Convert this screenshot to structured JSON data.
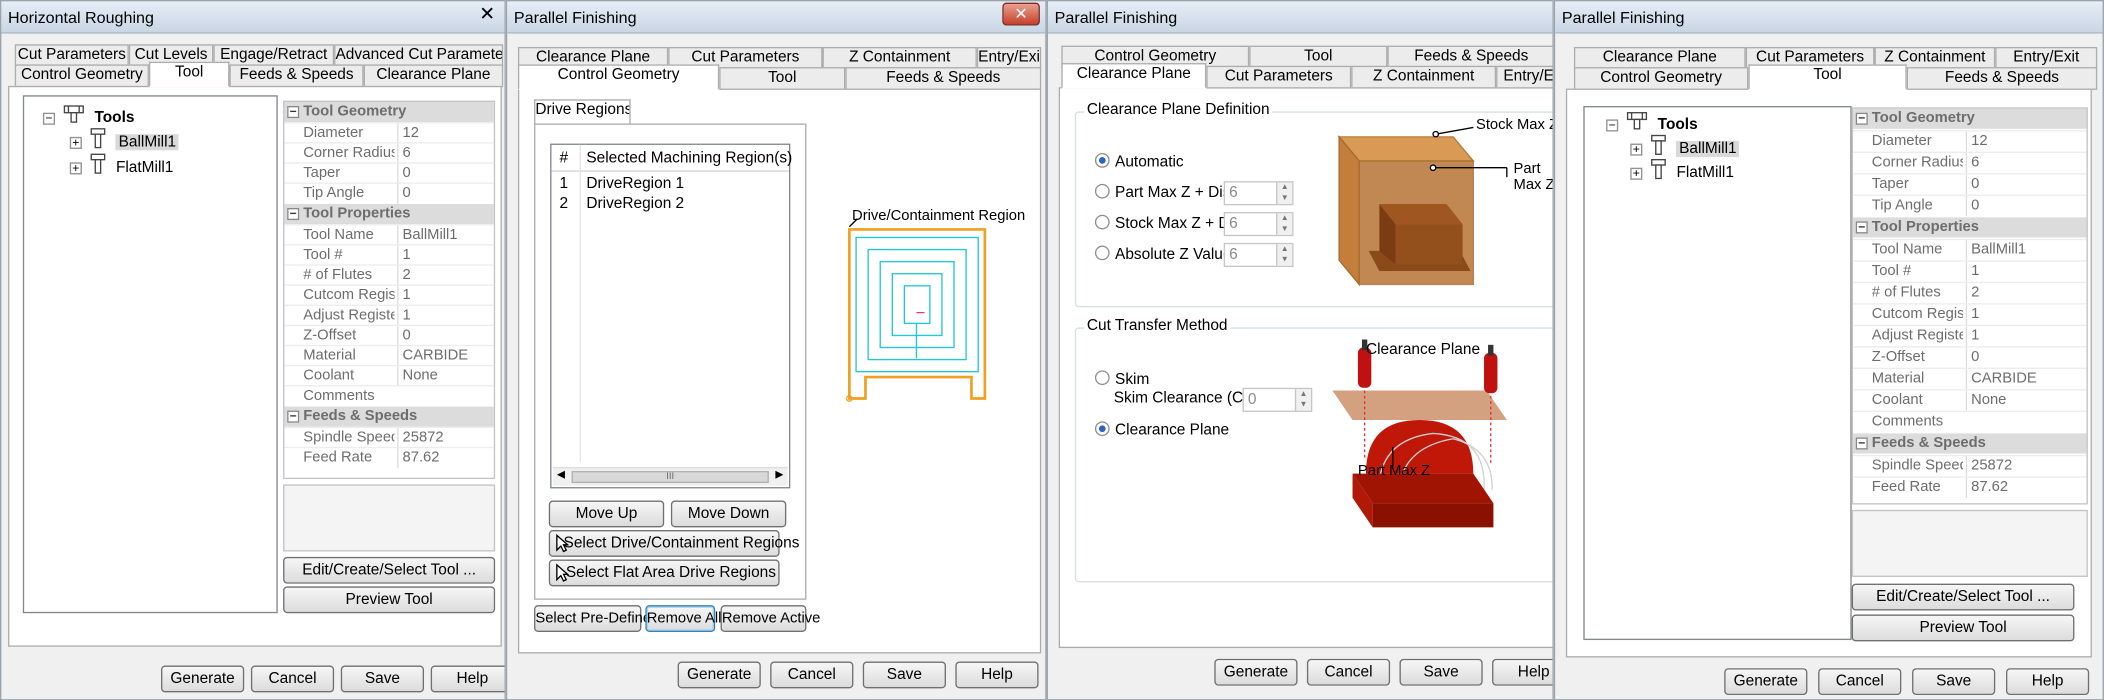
{
  "colors": {
    "title_bar": "#c9d6e4",
    "close": "#c7402c",
    "selection": "#d9d9d9",
    "drive_outline": "#f0a020",
    "toolpath": "#20c8d8",
    "model_orange": "#c46416",
    "model_red": "#c01808"
  },
  "common": {
    "generate": "Generate",
    "cancel": "Cancel",
    "save": "Save",
    "help": "Help"
  },
  "tool_tree": {
    "root": "Tools",
    "tools": [
      "BallMill1",
      "FlatMill1"
    ],
    "icon": "tool-holder-icon",
    "expander": "+"
  },
  "tool_props": {
    "geometry": {
      "title": "Tool Geometry",
      "rows": [
        {
          "k": "Diameter",
          "v": "12"
        },
        {
          "k": "Corner Radius",
          "v": "6"
        },
        {
          "k": "Taper",
          "v": "0"
        },
        {
          "k": "Tip Angle",
          "v": "0"
        }
      ]
    },
    "properties": {
      "title": "Tool Properties",
      "rows": [
        {
          "k": "Tool Name",
          "v": "BallMill1"
        },
        {
          "k": "Tool #",
          "v": "1"
        },
        {
          "k": "# of Flutes",
          "v": "2"
        },
        {
          "k": "Cutcom Register",
          "v": "1"
        },
        {
          "k": "Adjust Register",
          "v": "1"
        },
        {
          "k": "Z-Offset",
          "v": "0"
        },
        {
          "k": "Material",
          "v": "CARBIDE"
        },
        {
          "k": "Coolant",
          "v": "None"
        },
        {
          "k": "Comments",
          "v": ""
        }
      ]
    },
    "feeds": {
      "title": "Feeds & Speeds",
      "rows": [
        {
          "k": "Spindle Speed",
          "v": "25872"
        },
        {
          "k": "Feed Rate",
          "v": "87.62"
        }
      ]
    },
    "collapse": "−",
    "edit_button": "Edit/Create/Select Tool ...",
    "preview_button": "Preview Tool"
  },
  "w1": {
    "title": "Horizontal Roughing",
    "close": "✕",
    "tabs_top": [
      "Cut Parameters",
      "Cut Levels",
      "Engage/Retract",
      "Advanced Cut Parameters"
    ],
    "tabs_bottom": [
      "Control Geometry",
      "Tool",
      "Feeds & Speeds",
      "Clearance Plane"
    ]
  },
  "w2": {
    "title": "Parallel Finishing",
    "close": "✕",
    "tabs_top": [
      "Clearance Plane",
      "Cut Parameters",
      "Z Containment",
      "Entry/Exit"
    ],
    "tabs_bottom": [
      "Control Geometry",
      "Tool",
      "Feeds & Speeds"
    ],
    "inner_tab": "Drive Regions",
    "grid": {
      "headers": [
        "#",
        "Selected Machining Region(s)"
      ],
      "rows": [
        {
          "n": "1",
          "name": "DriveRegion 1"
        },
        {
          "n": "2",
          "name": "DriveRegion 2"
        }
      ],
      "scroll_glyph": "III"
    },
    "move_up": "Move Up",
    "move_down": "Move Down",
    "select_drive": "Select Drive/Containment Regions",
    "select_flat": "Select Flat Area Drive Regions",
    "select_predefined": "Select Pre-Defined",
    "remove_all": "Remove All",
    "remove_active": "Remove Active",
    "diagram_label": "Drive/Containment Region"
  },
  "w3": {
    "title": "Parallel Finishing",
    "tabs_top": [
      "Control Geometry",
      "Tool",
      "Feeds & Speeds"
    ],
    "tabs_bottom": [
      "Clearance Plane",
      "Cut Parameters",
      "Z Containment",
      "Entry/Exit"
    ],
    "clearance_group": "Clearance Plane Definition",
    "options": [
      {
        "label": "Automatic",
        "on": true,
        "value": ""
      },
      {
        "label": "Part Max Z + Dist",
        "on": false,
        "value": "6"
      },
      {
        "label": "Stock Max Z + Dist",
        "on": false,
        "value": "6"
      },
      {
        "label": "Absolute Z Value",
        "on": false,
        "value": "6"
      }
    ],
    "stock_label": "Stock Max Z",
    "part_label_1": "Part",
    "part_label_2": "Max Z",
    "transfer_group": "Cut Transfer Method",
    "skim": "Skim",
    "skim_clearance": "Skim Clearance (C)",
    "skim_value": "0",
    "clearance_plane": "Clearance Plane",
    "img_clearance_label": "Clearance Plane",
    "img_part_label": "Part Max Z"
  },
  "w4": {
    "title": "Parallel Finishing",
    "tabs_top": [
      "Clearance Plane",
      "Cut Parameters",
      "Z Containment",
      "Entry/Exit"
    ],
    "tabs_bottom": [
      "Control Geometry",
      "Tool",
      "Feeds & Speeds"
    ]
  }
}
